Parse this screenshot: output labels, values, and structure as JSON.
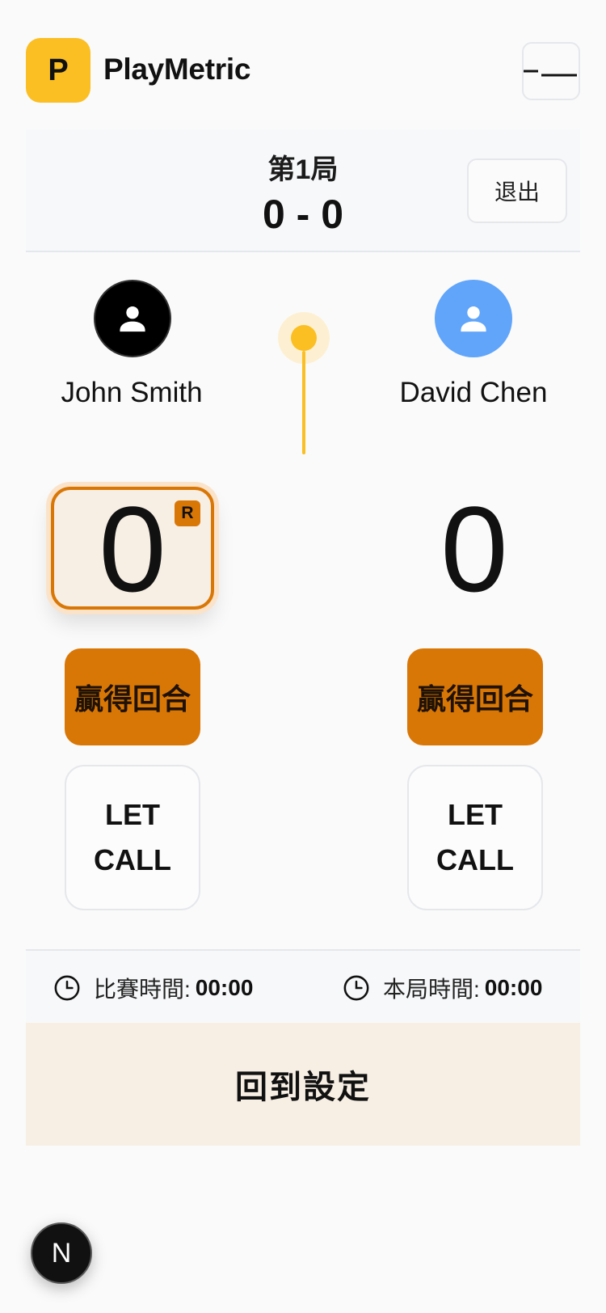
{
  "app": {
    "logo_letter": "P",
    "name": "PlayMetric"
  },
  "header": {
    "menu_icon": "hamburger-menu-icon"
  },
  "game": {
    "label": "第1局",
    "score": "0 - 0",
    "exit_label": "退出"
  },
  "players": {
    "left": {
      "name": "John Smith",
      "avatar_icon": "person-icon",
      "avatar_color": "#000000",
      "score": "0",
      "is_receiver": true,
      "receiver_badge": "R"
    },
    "right": {
      "name": "David Chen",
      "avatar_icon": "person-icon",
      "avatar_color": "#60a5fa",
      "score": "0"
    }
  },
  "serve_indicator": {
    "icon": "serve-marker-icon",
    "color": "#fbbf24"
  },
  "actions": {
    "win_rally_label": "贏得回合",
    "let_call_line1": "LET",
    "let_call_line2": "CALL"
  },
  "timers": {
    "match_label": "比賽時間:",
    "match_value": "00:00",
    "game_label": "本局時間:",
    "game_value": "00:00",
    "icon": "clock-icon"
  },
  "footer": {
    "back_label": "回到設定",
    "dev_badge": "N"
  },
  "colors": {
    "accent": "#d97706",
    "brand": "#fbbf24",
    "accent_light": "#f7eee4"
  }
}
